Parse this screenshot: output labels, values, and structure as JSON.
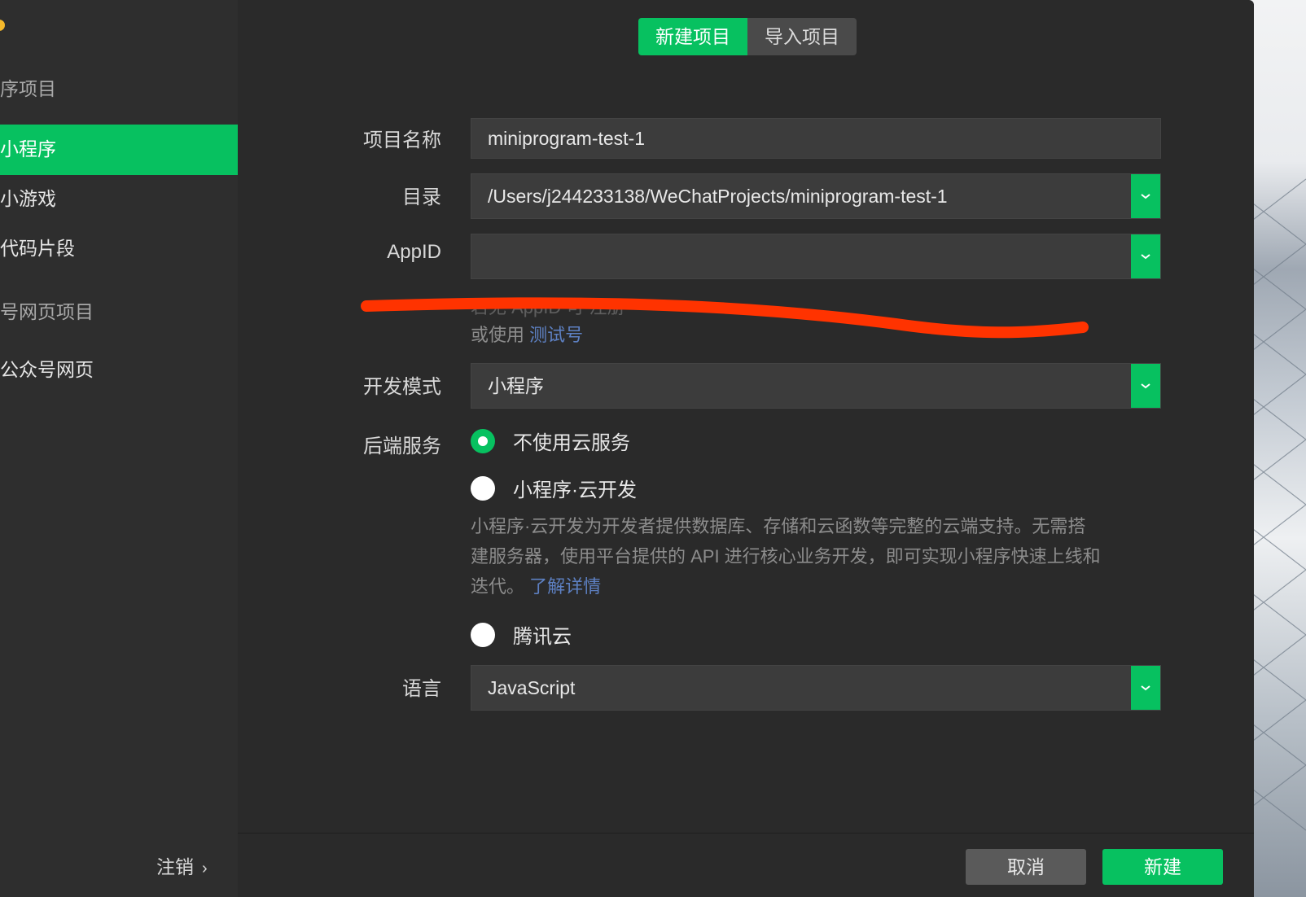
{
  "sidebar": {
    "section_mini": "序项目",
    "items": [
      {
        "label": "小程序",
        "active": true
      },
      {
        "label": "小游戏",
        "active": false
      },
      {
        "label": "代码片段",
        "active": false
      }
    ],
    "section_web": "号网页项目",
    "web_item": "公众号网页",
    "logout": "注销",
    "logout_chevron": "›"
  },
  "tabs": {
    "new_project": "新建项目",
    "import_project": "导入项目"
  },
  "form": {
    "name_label": "项目名称",
    "name_value": "miniprogram-test-1",
    "dir_label": "目录",
    "dir_value": "/Users/j244233138/WeChatProjects/miniprogram-test-1",
    "appid_label": "AppID",
    "appid_value": "",
    "appid_hint_obscured": "若无 AppID 可 注册",
    "appid_hint_prefix": "或使用",
    "appid_hint_link": "测试号",
    "mode_label": "开发模式",
    "mode_value": "小程序",
    "backend_label": "后端服务",
    "backend_options": [
      {
        "label": "不使用云服务",
        "selected": true
      },
      {
        "label": "小程序·云开发",
        "selected": false
      },
      {
        "label": "腾讯云",
        "selected": false
      }
    ],
    "cloud_desc_line1": "小程序·云开发为开发者提供数据库、存储和云函数等完整的云端支持。无需搭",
    "cloud_desc_line2": "建服务器，使用平台提供的 API 进行核心业务开发，即可实现小程序快速上线和",
    "cloud_desc_line3_prefix": "迭代。",
    "cloud_desc_link": "了解详情",
    "lang_label": "语言",
    "lang_value": "JavaScript"
  },
  "footer": {
    "cancel": "取消",
    "create": "新建"
  },
  "colors": {
    "accent": "#07c160",
    "bg": "#2a2a2a",
    "annotation": "#ff3300"
  },
  "icons": {
    "dropdown": "chevron-down-icon"
  }
}
